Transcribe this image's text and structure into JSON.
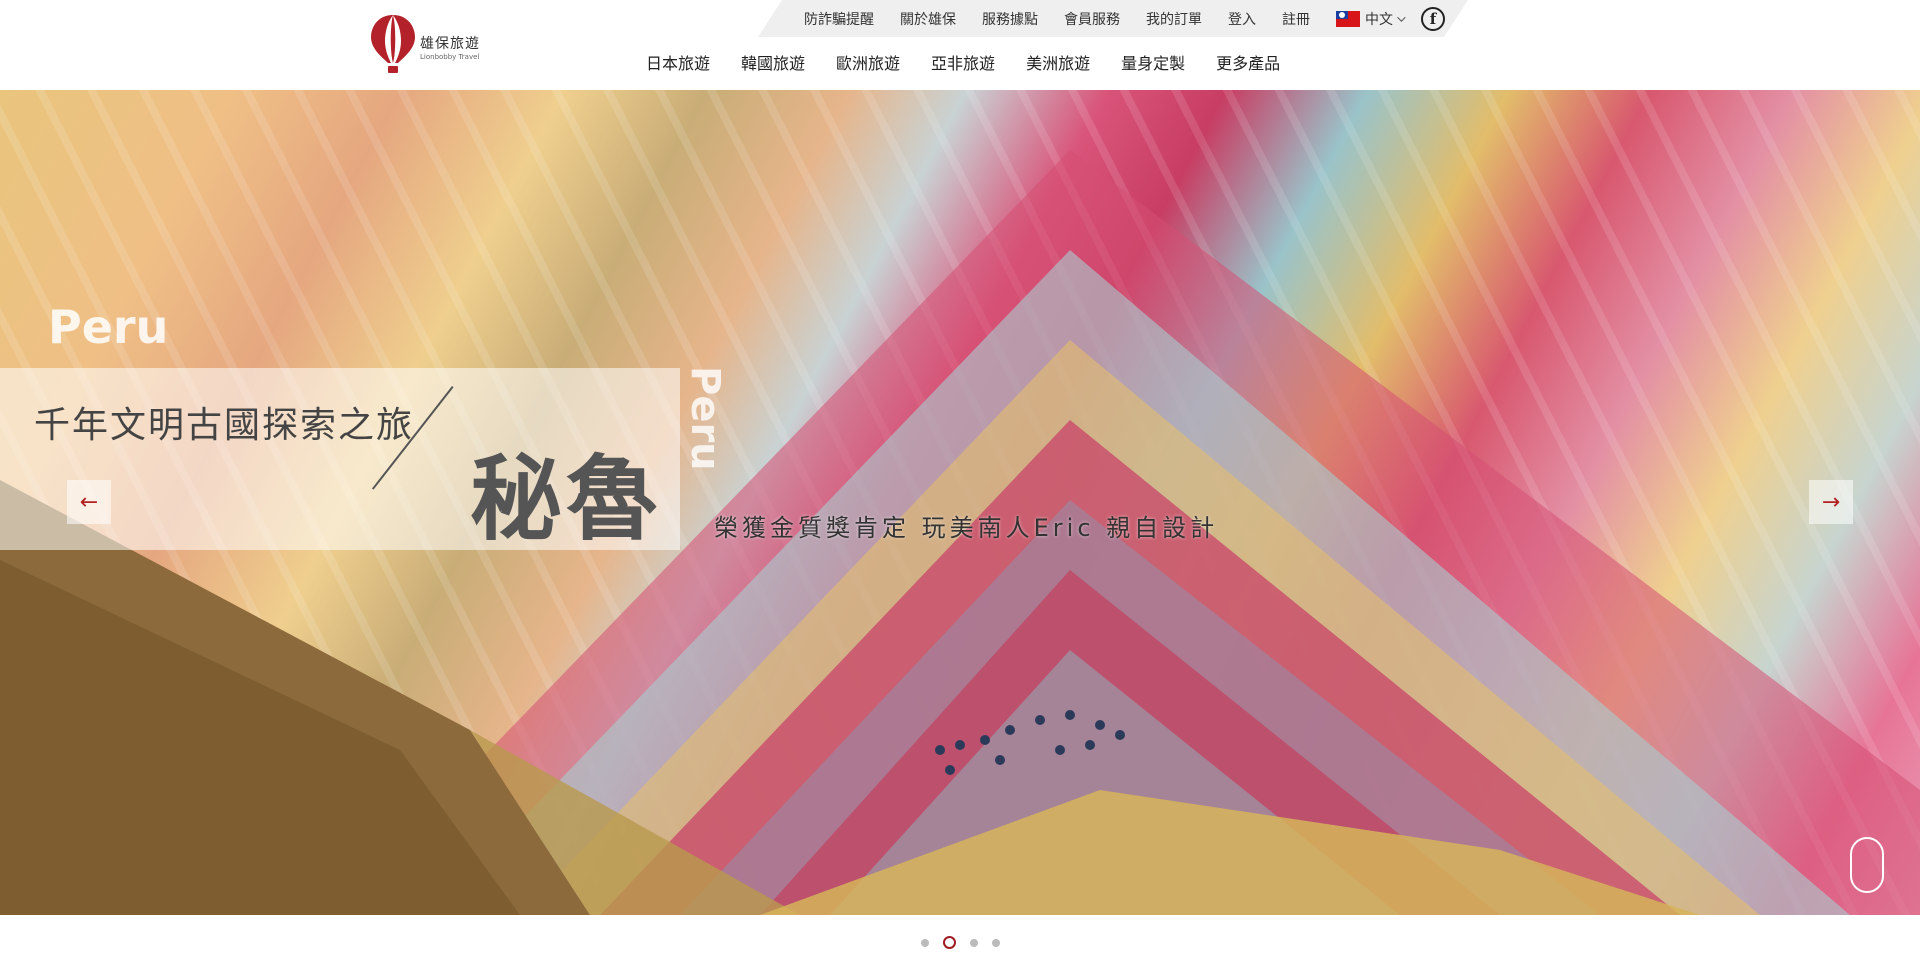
{
  "brand": {
    "name_cn": "雄保旅遊",
    "name_en": "Lionbobby Travel",
    "accent_color": "#a01c22"
  },
  "utility": {
    "links": [
      "防詐騙提醒",
      "關於雄保",
      "服務據點",
      "會員服務",
      "我的訂單",
      "登入",
      "註冊"
    ],
    "language": "中文",
    "language_icon": "taiwan-flag-icon",
    "social_icon": "facebook-icon"
  },
  "nav": {
    "items": [
      "日本旅遊",
      "韓國旅遊",
      "歐洲旅遊",
      "亞非旅遊",
      "美洲旅遊",
      "量身定製",
      "更多產品"
    ]
  },
  "hero": {
    "overlay_word": "Peru",
    "tagline": "千年文明古國探索之旅",
    "destination": "秘魯",
    "vertical_word": "Peru",
    "subtitle": "榮獲金質獎肯定 玩美南人Eric 親自設計",
    "prev_arrow": "←",
    "next_arrow": "→"
  },
  "carousel": {
    "slide_count": 4,
    "active_index": 1
  }
}
